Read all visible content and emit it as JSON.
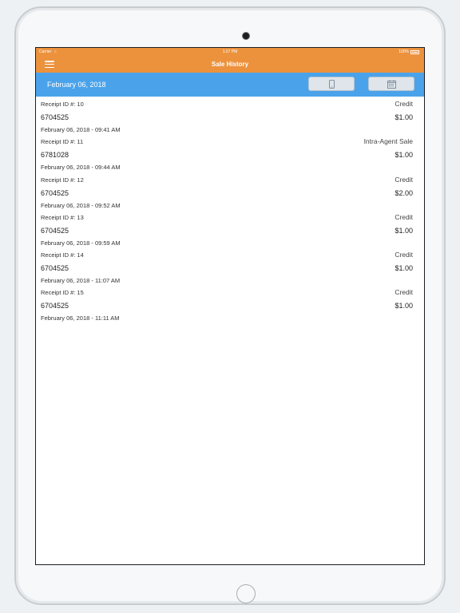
{
  "status_bar": {
    "carrier": "Carrier",
    "time": "1:27 PM",
    "battery": "100%"
  },
  "nav": {
    "title": "Sale History"
  },
  "date_bar": {
    "date": "February 06, 2018"
  },
  "receipts": [
    {
      "id_label": "Receipt ID #: 10",
      "type": "Credit",
      "account": "6704525",
      "amount": "$1.00",
      "timestamp": "February  06, 2018 - 09:41 AM"
    },
    {
      "id_label": "Receipt ID #: 11",
      "type": "Intra-Agent Sale",
      "account": "6781028",
      "amount": "$1.00",
      "timestamp": "February  06, 2018 - 09:44 AM"
    },
    {
      "id_label": "Receipt ID #: 12",
      "type": "Credit",
      "account": "6704525",
      "amount": "$2.00",
      "timestamp": "February  06, 2018 - 09:52 AM"
    },
    {
      "id_label": "Receipt ID #: 13",
      "type": "Credit",
      "account": "6704525",
      "amount": "$1.00",
      "timestamp": "February  06, 2018 - 09:59 AM"
    },
    {
      "id_label": "Receipt ID #: 14",
      "type": "Credit",
      "account": "6704525",
      "amount": "$1.00",
      "timestamp": "February  06, 2018 - 11:07 AM"
    },
    {
      "id_label": "Receipt ID #: 15",
      "type": "Credit",
      "account": "6704525",
      "amount": "$1.00",
      "timestamp": "February  06, 2018 - 11:11 AM"
    }
  ],
  "colors": {
    "header": "#ec923d",
    "date_bar": "#4aa3ea"
  },
  "icons": {
    "menu": "hamburger-menu-icon",
    "phone": "phone-icon",
    "calendar": "calendar-icon"
  }
}
